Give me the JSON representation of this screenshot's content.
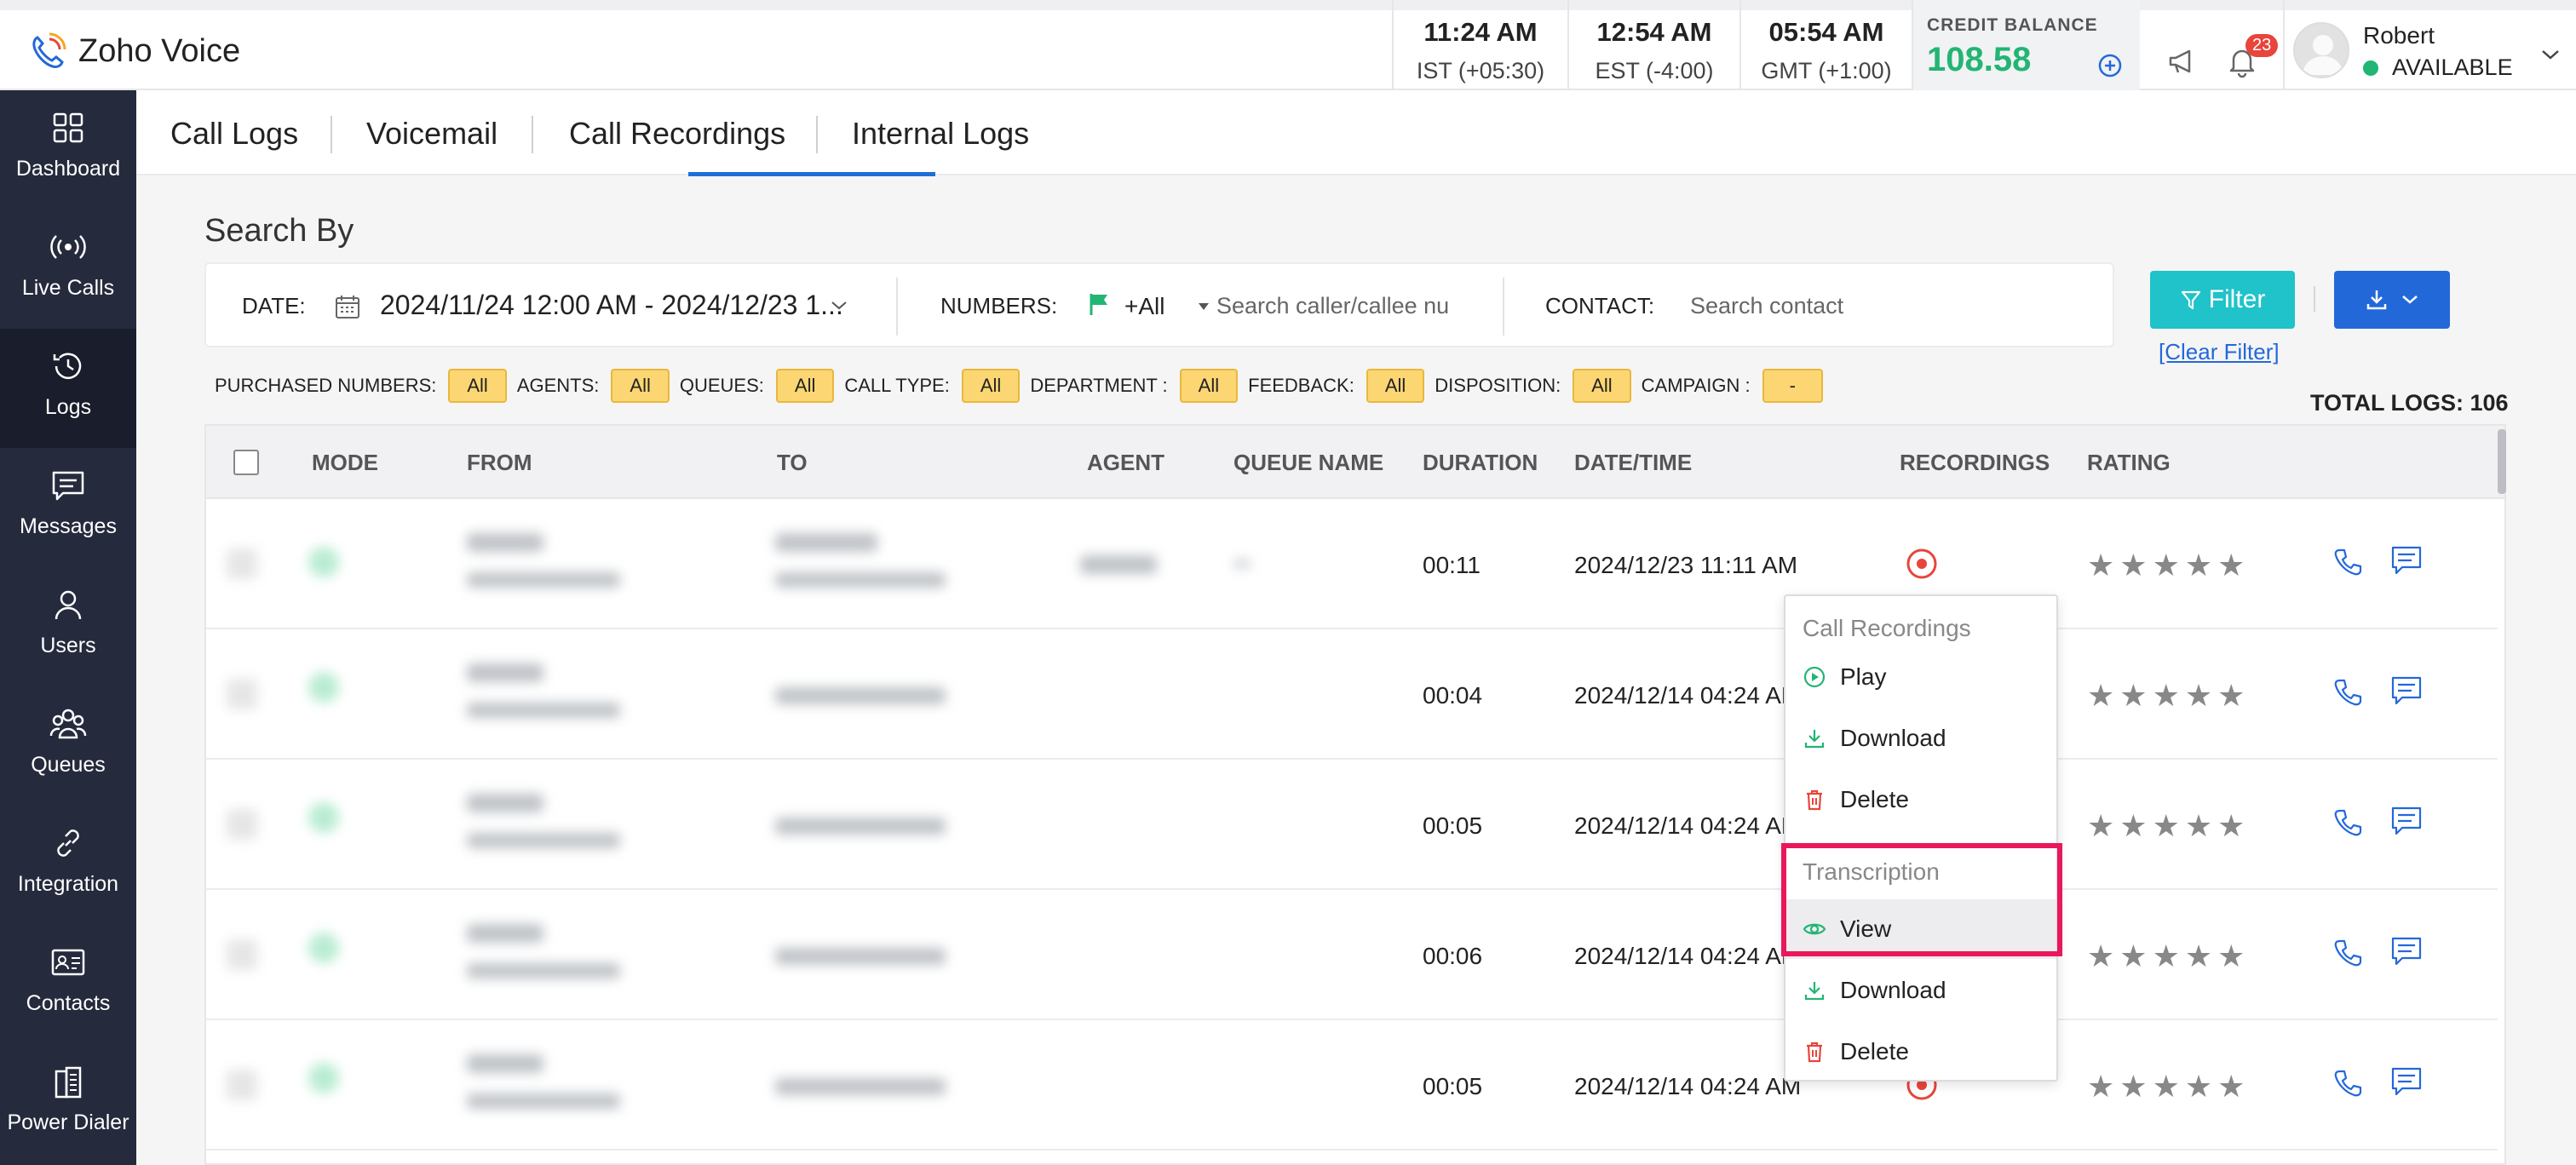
{
  "app": {
    "name": "Zoho Voice"
  },
  "header": {
    "clocks": [
      {
        "time": "11:24 AM",
        "zone": "IST (+05:30)"
      },
      {
        "time": "12:54 AM",
        "zone": "EST (-4:00)"
      },
      {
        "time": "05:54 AM",
        "zone": "GMT (+1:00)"
      }
    ],
    "credit_label": "CREDIT BALANCE",
    "credit_amount": "108.58",
    "notification_count": "23",
    "user_name": "Robert",
    "user_status": "AVAILABLE"
  },
  "sidebar": {
    "items": [
      {
        "label": "Dashboard",
        "icon": "grid-icon"
      },
      {
        "label": "Live Calls",
        "icon": "broadcast-icon"
      },
      {
        "label": "Logs",
        "icon": "history-icon",
        "active": true
      },
      {
        "label": "Messages",
        "icon": "message-icon"
      },
      {
        "label": "Users",
        "icon": "user-icon"
      },
      {
        "label": "Queues",
        "icon": "group-icon"
      },
      {
        "label": "Integration",
        "icon": "link-icon"
      },
      {
        "label": "Contacts",
        "icon": "contact-card-icon"
      },
      {
        "label": "Power Dialer",
        "icon": "dialer-icon"
      }
    ]
  },
  "tabs": [
    {
      "label": "Call Logs"
    },
    {
      "label": "Voicemail"
    },
    {
      "label": "Call Recordings",
      "active": true
    },
    {
      "label": "Internal Logs"
    }
  ],
  "search": {
    "title": "Search By",
    "date_label": "DATE:",
    "date_value": "2024/11/24 12:00 AM - 2024/12/23 1...",
    "numbers_label": "NUMBERS:",
    "numbers_value": "+All",
    "numbers_placeholder": "Search caller/callee nu",
    "contact_label": "CONTACT:",
    "contact_placeholder": "Search contact",
    "filter_button": "Filter",
    "clear_filter": "[Clear Filter]"
  },
  "chips": [
    {
      "label": "PURCHASED NUMBERS:",
      "value": "All"
    },
    {
      "label": "AGENTS:",
      "value": "All"
    },
    {
      "label": "QUEUES:",
      "value": "All"
    },
    {
      "label": "CALL TYPE:",
      "value": "All"
    },
    {
      "label": "DEPARTMENT :",
      "value": "All"
    },
    {
      "label": "FEEDBACK:",
      "value": "All"
    },
    {
      "label": "DISPOSITION:",
      "value": "All"
    },
    {
      "label": "CAMPAIGN :",
      "value": "-"
    }
  ],
  "total_logs": "TOTAL LOGS: 106",
  "table": {
    "columns": [
      "MODE",
      "FROM",
      "TO",
      "AGENT",
      "QUEUE NAME",
      "DURATION",
      "DATE/TIME",
      "RECORDINGS",
      "RATING"
    ],
    "rows": [
      {
        "duration": "00:11",
        "datetime": "2024/12/23 11:11 AM"
      },
      {
        "duration": "00:04",
        "datetime": "2024/12/14 04:24 AM"
      },
      {
        "duration": "00:05",
        "datetime": "2024/12/14 04:24 AM"
      },
      {
        "duration": "00:06",
        "datetime": "2024/12/14 04:24 AM"
      },
      {
        "duration": "00:05",
        "datetime": "2024/12/14 04:24 AM"
      }
    ]
  },
  "recording_menu": {
    "recordings_header": "Call Recordings",
    "recordings_items": [
      "Play",
      "Download",
      "Delete"
    ],
    "transcription_header": "Transcription",
    "transcription_items": [
      "View",
      "Download",
      "Delete"
    ]
  },
  "colors": {
    "accent": "#2368d9",
    "filter": "#1fc3c9",
    "credit": "#22b573",
    "highlight": "#e8185a",
    "sidebar": "#262a3d"
  }
}
